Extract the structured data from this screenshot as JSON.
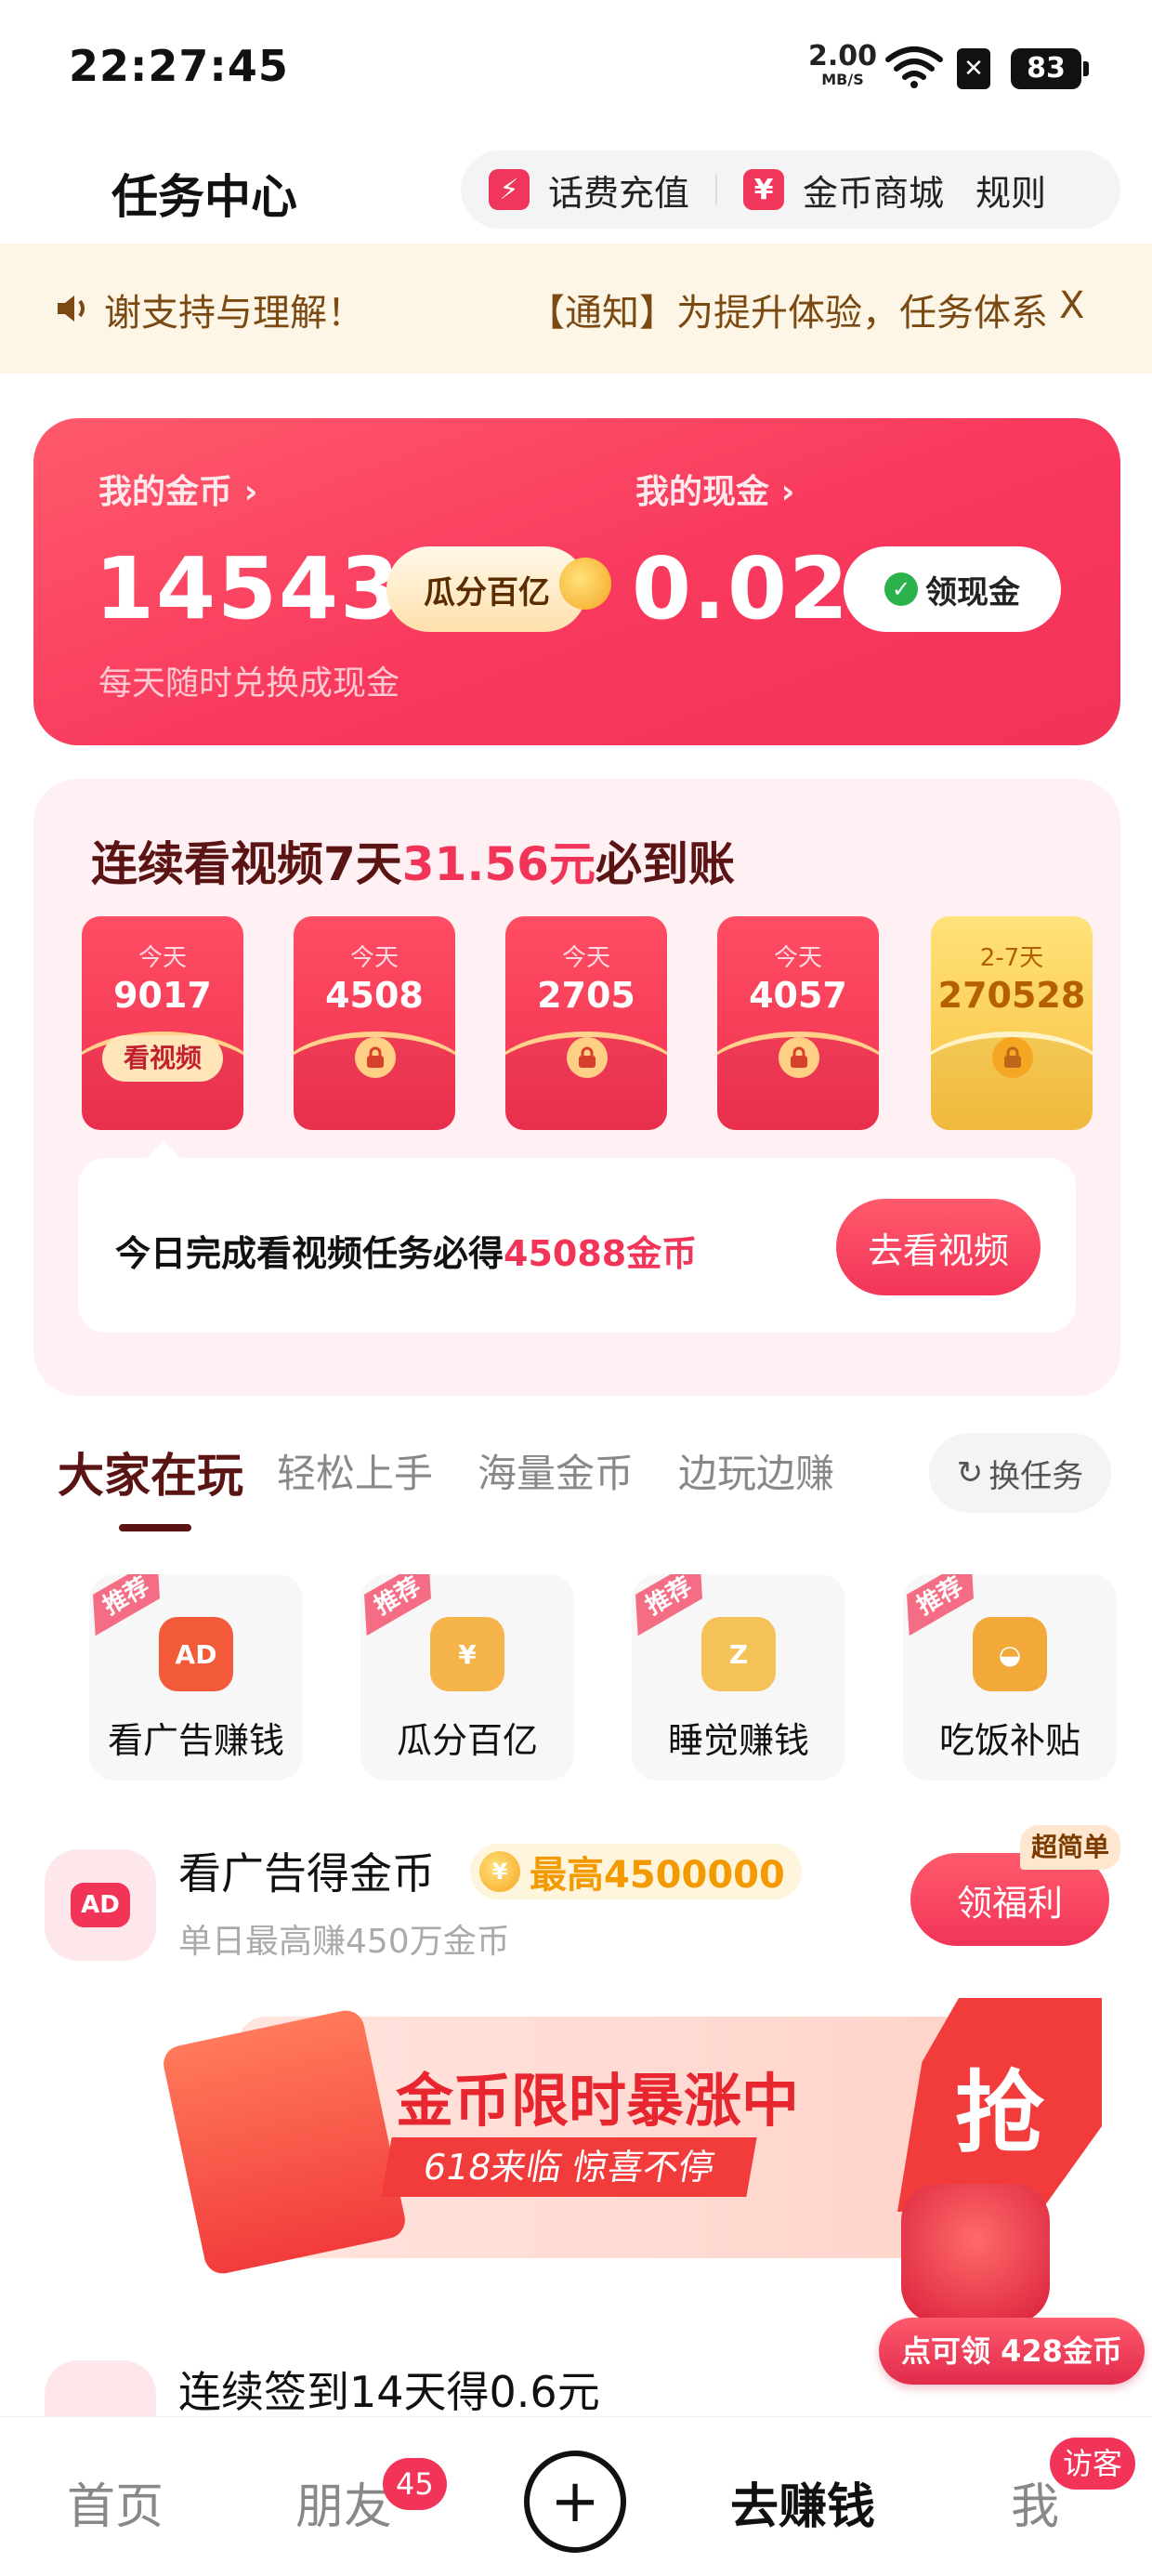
{
  "status_bar": {
    "time": "22:27:45",
    "net_speed": "2.00",
    "net_unit": "MB/S",
    "battery": "83"
  },
  "header": {
    "title": "任务中心",
    "links": [
      {
        "label": "话费充值",
        "icon": "phone-topup-icon"
      },
      {
        "label": "金币商城",
        "icon": "coin-mall-icon"
      },
      {
        "label": "规则"
      }
    ]
  },
  "notice": {
    "text_tail": "谢支持与理解！",
    "text_head": "【通知】为提升体验，任务体系",
    "close": "X"
  },
  "coin_card": {
    "coins_label": "我的金币",
    "coins_value": "14543",
    "coins_action": "瓜分百亿",
    "cash_label": "我的现金",
    "cash_value": "0.02",
    "cash_action": "领现金",
    "subtitle": "每天随时兑换成现金"
  },
  "streak": {
    "title_prefix": "连续看视频7天",
    "title_amount": "31.56元",
    "title_suffix": "必到账",
    "envelopes": [
      {
        "day": "今天",
        "coins": "9017",
        "action": "看视频",
        "locked": false
      },
      {
        "day": "今天",
        "coins": "4508",
        "locked": true
      },
      {
        "day": "今天",
        "coins": "2705",
        "locked": true
      },
      {
        "day": "今天",
        "coins": "4057",
        "locked": true
      },
      {
        "day": "2-7天",
        "coins": "270528",
        "locked": true
      }
    ],
    "bottom_prefix": "今日完成看视频任务必得",
    "bottom_amount": "45088金币",
    "bottom_button": "去看视频"
  },
  "tabs": {
    "items": [
      "大家在玩",
      "轻松上手",
      "海量金币",
      "边玩边赚"
    ],
    "active": "大家在玩",
    "refresh": "换任务"
  },
  "featured": [
    {
      "tag": "推荐",
      "label": "看广告赚钱",
      "icon": "ad-tv-icon"
    },
    {
      "tag": "推荐",
      "label": "瓜分百亿",
      "icon": "coin-hand-icon"
    },
    {
      "tag": "推荐",
      "label": "睡觉赚钱",
      "icon": "sleeping-icon"
    },
    {
      "tag": "推荐",
      "label": "吃饭补贴",
      "icon": "food-bowl-icon"
    }
  ],
  "task_ad": {
    "icon_text": "AD",
    "title": "看广告得金币",
    "badge": "最高4500000",
    "subtitle": "单日最高赚450万金币",
    "button": "领福利",
    "corner": "超简单"
  },
  "banner": {
    "title": "金币限时暴涨中",
    "subtitle": "618来临 惊喜不停",
    "grab": "抢"
  },
  "task_checkin": {
    "title": "连续签到14天得0.6元",
    "float_reward": "点可领 428金币"
  },
  "bottom_nav": {
    "items": [
      "首页",
      "朋友",
      "去赚钱",
      "我"
    ],
    "friends_badge": "45",
    "me_badge": "访客",
    "active": "去赚钱"
  },
  "colors": {
    "accent": "#f23458",
    "notice_bg": "#fdf6e6",
    "dark_red": "#5a1414"
  }
}
